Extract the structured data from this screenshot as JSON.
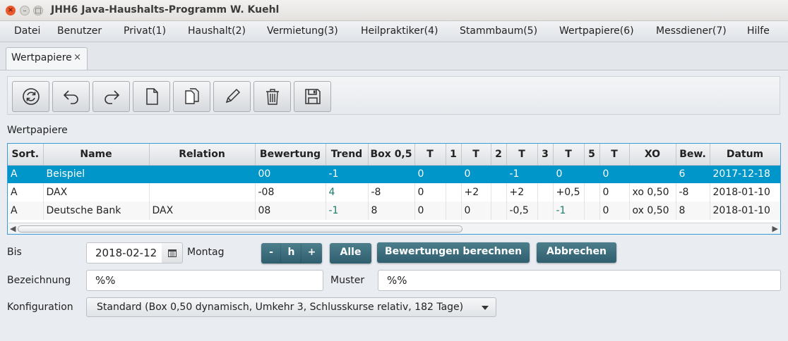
{
  "window": {
    "title": "JHH6 Java-Haushalts-Programm W. Kuehl",
    "close_glyph": "×",
    "min_glyph": "–",
    "max_glyph": "□"
  },
  "menu": [
    "Datei",
    "Benutzer",
    "Privat(1)",
    "Haushalt(2)",
    "Vermietung(3)",
    "Heilpraktiker(4)",
    "Stammbaum(5)",
    "Wertpapiere(6)",
    "Messdiener(7)",
    "Hilfe"
  ],
  "tab": {
    "label": "Wertpapiere",
    "close_glyph": "×"
  },
  "toolbar": [
    "refresh-icon",
    "undo-icon",
    "redo-icon",
    "new-document-icon",
    "copy-document-icon",
    "edit-pencil-icon",
    "delete-trash-icon",
    "save-disk-icon"
  ],
  "section_label": "Wertpapiere",
  "table": {
    "headers": [
      "Sort.",
      "Name",
      "Relation",
      "Bewertung",
      "Trend",
      "Box 0,5",
      "T",
      "1",
      "T",
      "2",
      "T",
      "3",
      "T",
      "5",
      "T",
      "XO",
      "Bew.",
      "Datum"
    ],
    "rows": [
      [
        "A",
        "Beispiel",
        "",
        "00",
        "-1",
        "",
        "0",
        "",
        "0",
        "",
        "-1",
        "",
        "0",
        "",
        "0",
        "",
        "6",
        "2017-12-18"
      ],
      [
        "A",
        "DAX",
        "",
        "-08",
        "4",
        "-8",
        "0",
        "",
        "+2",
        "",
        "+2",
        "",
        "+0,5",
        "",
        "0",
        "xo 0,50",
        "-8",
        "2018-01-10"
      ],
      [
        "A",
        "Deutsche Bank",
        "DAX",
        "08",
        "-1",
        "8",
        "0",
        "",
        "0",
        "",
        "-0,5",
        "",
        "-1",
        "",
        "0",
        "ox 0,50",
        "8",
        "2018-01-10"
      ]
    ],
    "selected_row": 0
  },
  "form": {
    "bis_label": "Bis",
    "bis_value": "2018-02-12",
    "weekday": "Montag",
    "minus_label": "-",
    "h_label": "h",
    "plus_label": "+",
    "alle_label": "Alle",
    "bewertungen_label": "Bewertungen berechnen",
    "abbrechen_label": "Abbrechen",
    "bezeichnung_label": "Bezeichnung",
    "bezeichnung_value": "%%",
    "muster_label": "Muster",
    "muster_value": "%%",
    "konfiguration_label": "Konfiguration",
    "konfiguration_value": "Standard (Box 0,50 dynamisch, Umkehr 3, Schlusskurse relativ, 182 Tage)"
  },
  "colors": {
    "selection": "#0096c9",
    "button_dark": "#3b6b7a",
    "trend_teal": "#1a7a6a"
  }
}
